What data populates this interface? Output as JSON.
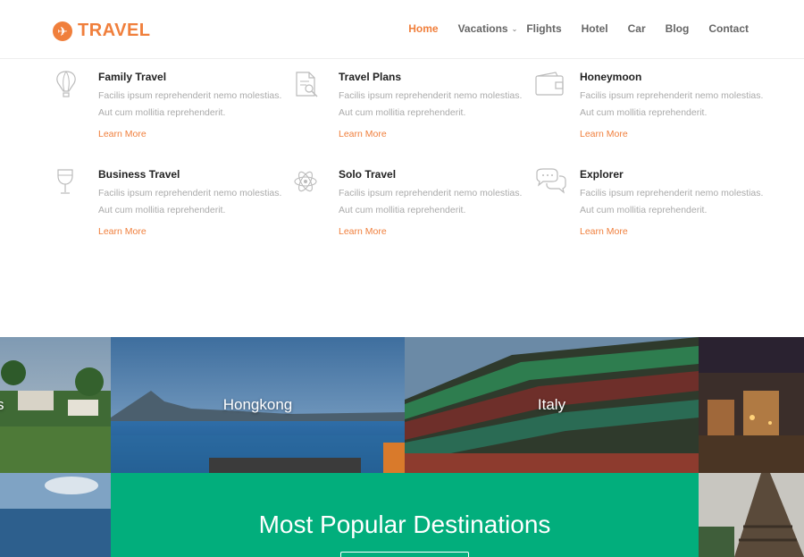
{
  "brand": {
    "name": "TRAVEL",
    "icon": "plane-icon",
    "color": "#f07f3c"
  },
  "nav": {
    "items": [
      {
        "label": "Home",
        "active": true
      },
      {
        "label": "Vacations",
        "dropdown": true
      },
      {
        "label": "Flights"
      },
      {
        "label": "Hotel"
      },
      {
        "label": "Car"
      },
      {
        "label": "Blog"
      },
      {
        "label": "Contact"
      }
    ]
  },
  "services": [
    {
      "title": "Family Travel",
      "icon": "balloon-icon",
      "text": "Facilis ipsum reprehenderit nemo molestias. Aut cum mollitia reprehenderit.",
      "link": "Learn More"
    },
    {
      "title": "Travel Plans",
      "icon": "document-search-icon",
      "text": "Facilis ipsum reprehenderit nemo molestias. Aut cum mollitia reprehenderit.",
      "link": "Learn More"
    },
    {
      "title": "Honeymoon",
      "icon": "wallet-icon",
      "text": "Facilis ipsum reprehenderit nemo molestias. Aut cum mollitia reprehenderit.",
      "link": "Learn More"
    },
    {
      "title": "Business Travel",
      "icon": "wine-glass-icon",
      "text": "Facilis ipsum reprehenderit nemo molestias. Aut cum mollitia reprehenderit.",
      "link": "Learn More"
    },
    {
      "title": "Solo Travel",
      "icon": "atom-icon",
      "text": "Facilis ipsum reprehenderit nemo molestias. Aut cum mollitia reprehenderit.",
      "link": "Learn More"
    },
    {
      "title": "Explorer",
      "icon": "chat-bubbles-icon",
      "text": "Facilis ipsum reprehenderit nemo molestias. Aut cum mollitia reprehenderit.",
      "link": "Learn More"
    }
  ],
  "destinations": [
    {
      "label": "s"
    },
    {
      "label": "Hongkong"
    },
    {
      "label": "Italy"
    },
    {
      "label": ""
    }
  ],
  "popular": {
    "title": "Most Popular Destinations",
    "accent": "#02ae7c"
  }
}
